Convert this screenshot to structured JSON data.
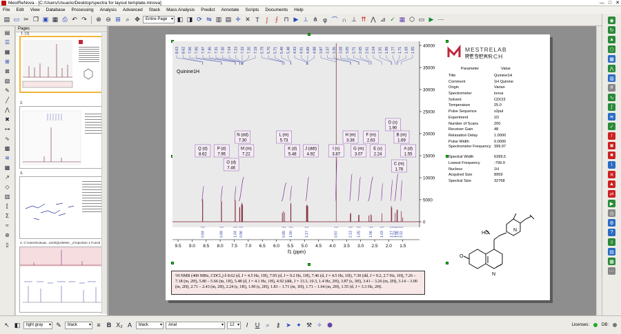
{
  "window": {
    "title": "MestReNova - [C:/Users/Usuario/Desktop/spectra for layout template.mnova]"
  },
  "menu": [
    "File",
    "Edit",
    "View",
    "Database",
    "Processing",
    "Analysis",
    "Advanced",
    "Stack",
    "Mass Analysis",
    "Predict",
    "Annotate",
    "Scripts",
    "Documents",
    "Help"
  ],
  "toolbar": {
    "page_combo": "Entire Page"
  },
  "pages_panel": {
    "title": "Pages",
    "items": [
      {
        "label": "1. [1]"
      },
      {
        "label": "2."
      },
      {
        "label": "3."
      },
      {
        "label": "4. C:\\Users\\Usuar...ox\\3\\QUININA _d Injection 1 Functi"
      }
    ]
  },
  "spectrum": {
    "title": "Quinine1H",
    "x_axis_label": "f1 (ppm)",
    "x_ticks": [
      "9.5",
      "9.0",
      "8.5",
      "8.0",
      "7.5",
      "7.0",
      "6.5",
      "6.0",
      "5.5",
      "5.0",
      "4.5",
      "4.0",
      "3.5",
      "3.0",
      "2.5",
      "2.0",
      "1.5"
    ],
    "y_ticks": [
      "40000",
      "35000",
      "30000",
      "25000",
      "20000",
      "15000",
      "10000",
      "5000",
      "0"
    ],
    "peak_labels_top": [
      "8.63",
      "8.62",
      "7.96",
      "7.95",
      "7.47",
      "7.46",
      "7.31",
      "7.30",
      "7.24",
      "7.23",
      "7.22",
      "7.20",
      "7.19",
      "5.79",
      "5.76",
      "5.71",
      "5.49",
      "5.48",
      "4.93",
      "4.91",
      "4.89",
      "4.88",
      "3.87",
      "3.37",
      "3.35",
      "3.08",
      "3.05",
      "2.71",
      "2.65",
      "2.61",
      "2.24",
      "1.91",
      "1.89",
      "1.77",
      "1.71",
      "1.69",
      "1.55"
    ],
    "integrals_bottom": [
      "0.94",
      "0.99",
      "1.04",
      "0.96",
      "0.95",
      "1.00",
      "1.17",
      "0.97",
      "2.13",
      "1.05",
      "1.06",
      "1.03",
      "1.17",
      "1.02",
      "1.06",
      "3.11"
    ],
    "multiplets": [
      {
        "name": "Q (d)",
        "shift": "8.62"
      },
      {
        "name": "P (d)",
        "shift": "7.95"
      },
      {
        "name": "N (dd)",
        "shift": "7.30"
      },
      {
        "name": "M (m)",
        "shift": "7.22"
      },
      {
        "name": "O (d)",
        "shift": "7.46"
      },
      {
        "name": "L (m)",
        "shift": "5.73"
      },
      {
        "name": "K (d)",
        "shift": "5.48"
      },
      {
        "name": "J (ddt)",
        "shift": "4.92"
      },
      {
        "name": "I (s)",
        "shift": "3.87"
      },
      {
        "name": "H (m)",
        "shift": "3.36"
      },
      {
        "name": "G (m)",
        "shift": "3.07"
      },
      {
        "name": "F (m)",
        "shift": "2.63"
      },
      {
        "name": "E (s)",
        "shift": "2.24"
      },
      {
        "name": "D (s)",
        "shift": "1.90"
      },
      {
        "name": "B (m)",
        "shift": "1.69"
      },
      {
        "name": "A (d)",
        "shift": "1.55"
      },
      {
        "name": "C (m)",
        "shift": "1.78"
      }
    ]
  },
  "company": {
    "name": "MESTRELAB RESEARCH",
    "sub": "NMR Solutions"
  },
  "parameters": {
    "header": [
      "Parameter",
      "Value"
    ],
    "rows": [
      [
        "Title",
        "Quinine1H"
      ],
      [
        "Comment",
        "1H Quinine"
      ],
      [
        "Origin",
        "Varian"
      ],
      [
        "Spectrometer",
        "inova"
      ],
      [
        "Solvent",
        "CDCl3"
      ],
      [
        "Temperature",
        "25.0"
      ],
      [
        "Pulse Sequence",
        "s2pul"
      ],
      [
        "Experiment",
        "1D"
      ],
      [
        "Number of Scans",
        "200"
      ],
      [
        "Receiver Gain",
        "48"
      ],
      [
        "Relaxation Delay",
        "1.0000"
      ],
      [
        "Pulse Width",
        "0.0000"
      ],
      [
        "Spectrometer Frequency",
        "399.97"
      ],
      [
        "Spectral Width",
        "6399.5"
      ],
      [
        "Lowest Frequency",
        "-799.9"
      ],
      [
        "Nucleus",
        "1H"
      ],
      [
        "Acquired Size",
        "8959"
      ],
      [
        "Spectral Size",
        "32768"
      ]
    ]
  },
  "molecule_labels": {
    "ho": "HO",
    "n1": "N",
    "n2": "N",
    "o": "O"
  },
  "report_text": "¹H NMR (400 MHz, CDCl₃) δ 8.62 (d, J = 4.5 Hz, 1H), 7.95 (d, J = 9.2 Hz, 1H), 7.46 (d, J = 4.5 Hz, 1H), 7.30 (dd, J = 9.2, 2.7 Hz, 1H), 7.26 – 7.18 (m, 2H), 5.80 – 5.66 (m, 1H), 5.48 (d, J = 4.1 Hz, 1H), 4.92 (ddt, J = 13.3, 10.3, 1.4 Hz, 2H), 3.87 (s, 3H), 3.41 – 3.26 (m, 2H), 3.14 – 3.00 (m, 2H), 2.71 – 2.43 (m, 2H), 2.24 (s, 1H), 1.90 (s, 2H), 1.83 – 1.71 (m, 1H), 1.71 – 1.64 (m, 2H), 1.55 (d, J = 3.3 Hz, 2H).",
  "statusbar": {
    "fill_color": "light gray",
    "line_color": "black",
    "font_color": "black",
    "font": "Arial",
    "font_size": "12",
    "licenses": "Licenses:",
    "db": "DB:"
  },
  "colors": {
    "spectrum": "#7a1c2c",
    "integral": "#7a2e99",
    "label": "#2838a0",
    "box_border": "#8a5aa6",
    "box_fill": "#f5ecf6",
    "selection": "#f2b53a"
  }
}
